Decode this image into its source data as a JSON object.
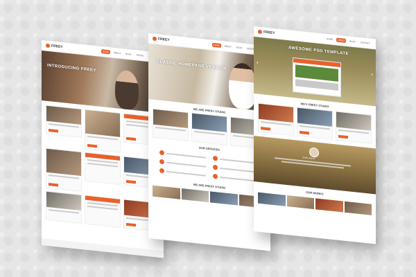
{
  "brand": "FREEY",
  "nav_items": [
    "HOME",
    "ABOUT",
    "BLOG",
    "PAGES",
    "CONTACT",
    "SHOP"
  ],
  "sheet1": {
    "hero_title": "INTRODUCING FREEY"
  },
  "sheet2": {
    "hero_title": "CLASSIC HOMEPAGE VERSION",
    "studio_title": "WE ARE FREEY STUDIO",
    "services_title": "OUR SERVICES",
    "studio_title_2": "WE ARE FREEY STUDIO"
  },
  "sheet3": {
    "hero_title": "AWESOME PSD TEMPLATE",
    "studio_title": "WE'S FREEY STUDIO",
    "testimonial_name": "JOHN SMITH",
    "works_title": "OUR WORKS"
  },
  "colors": {
    "accent": "#e8612c",
    "background": "#e6e6e6"
  }
}
